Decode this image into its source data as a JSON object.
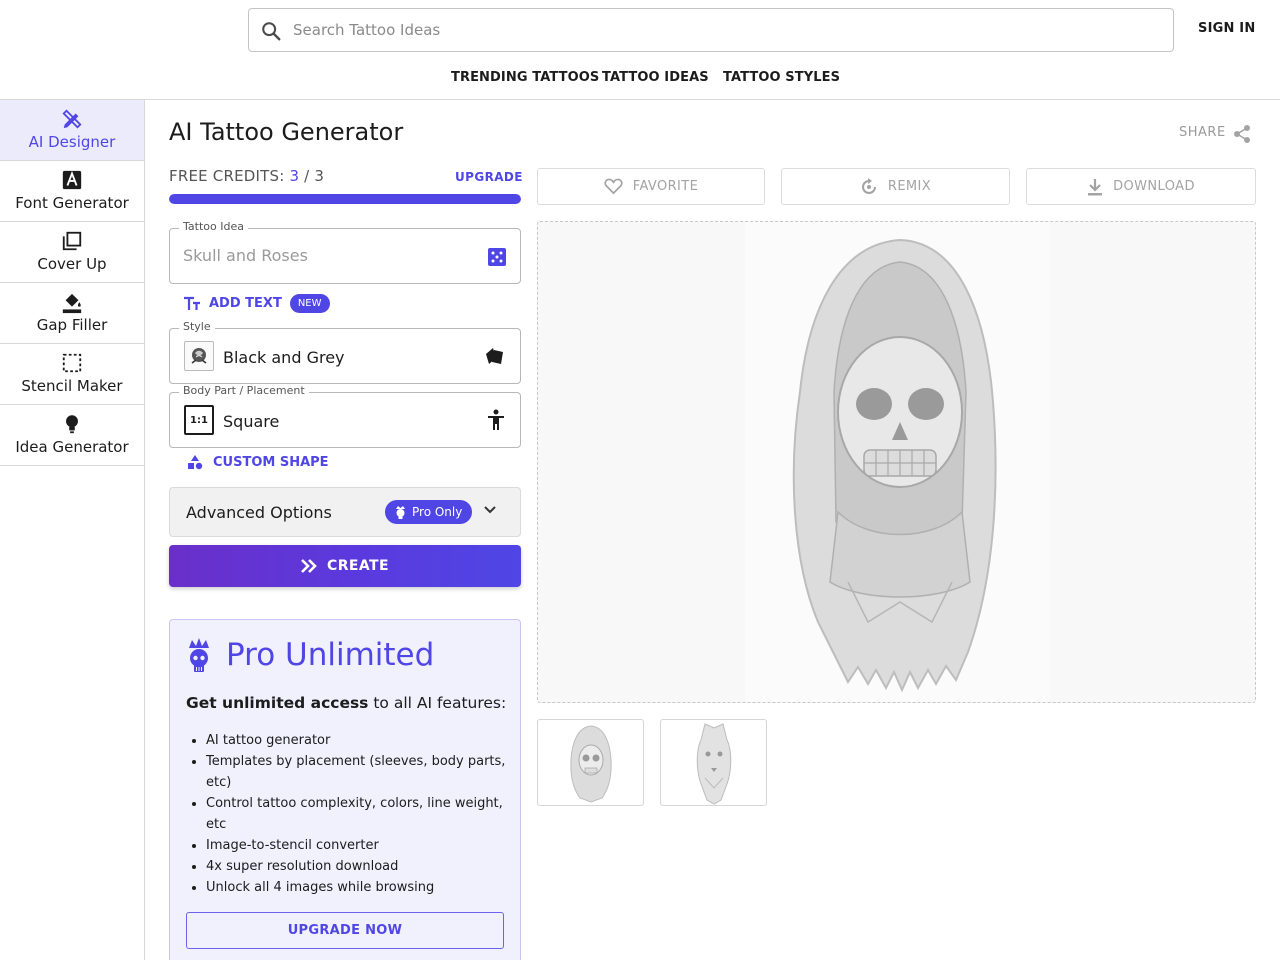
{
  "header": {
    "search_placeholder": "Search Tattoo Ideas",
    "sign_in": "SIGN IN",
    "nav": [
      "TRENDING TATTOOS",
      "TATTOO IDEAS",
      "TATTOO STYLES"
    ]
  },
  "sidebar": {
    "items": [
      {
        "label": "AI Designer",
        "icon": "pencil-ruler-icon",
        "active": true
      },
      {
        "label": "Font Generator",
        "icon": "font-icon"
      },
      {
        "label": "Cover Up",
        "icon": "layers-icon"
      },
      {
        "label": "Gap Filler",
        "icon": "paint-bucket-icon"
      },
      {
        "label": "Stencil Maker",
        "icon": "dashed-select-icon"
      },
      {
        "label": "Idea Generator",
        "icon": "lightbulb-icon"
      }
    ]
  },
  "main": {
    "title": "AI Tattoo Generator",
    "share": "SHARE",
    "credits": {
      "label": "FREE CREDITS:",
      "used": "3",
      "sep": "/",
      "total": "3",
      "fill": 1.0
    },
    "upgrade": "UPGRADE",
    "tattoo_idea": {
      "label": "Tattoo Idea",
      "placeholder": "Skull and Roses"
    },
    "add_text": "ADD TEXT",
    "new_badge": "NEW",
    "style": {
      "label": "Style",
      "value": "Black and Grey"
    },
    "placement": {
      "label": "Body Part / Placement",
      "value": "Square",
      "ratio": "1:1"
    },
    "custom_shape": "CUSTOM SHAPE",
    "advanced": {
      "label": "Advanced Options",
      "badge": "Pro Only"
    },
    "create": "CREATE",
    "pro": {
      "title": "Pro Unlimited",
      "sub_bold": "Get unlimited access",
      "sub_rest": " to all AI features:",
      "features": [
        "AI tattoo generator",
        "Templates by placement (sleeves, body parts, etc)",
        "Control tattoo complexity, colors, line weight, etc",
        "Image-to-stencil converter",
        "4x super resolution download",
        "Unlock all 4 images while browsing"
      ],
      "button": "UPGRADE NOW"
    }
  },
  "right": {
    "actions": [
      "FAVORITE",
      "REMIX",
      "DOWNLOAD"
    ]
  },
  "colors": {
    "accent": "#4f46e5",
    "active_bg": "#ecebfb",
    "pro_bg": "#f1f0fd"
  }
}
